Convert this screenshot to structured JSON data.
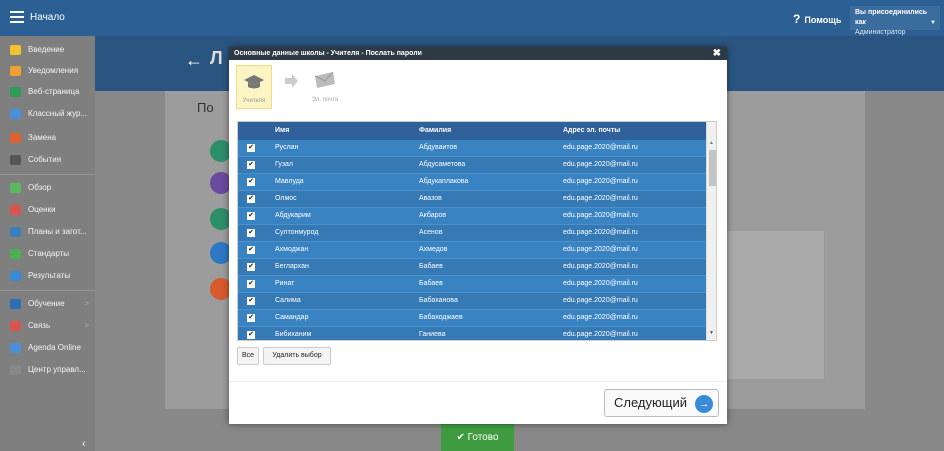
{
  "topbar": {
    "home_label": "Начало",
    "help_label": "Помощь",
    "user_line1": "Вы присоединились как",
    "user_line2": "Администратор"
  },
  "sidebar": {
    "items": [
      {
        "label": "Введение",
        "icon": "star-icon",
        "color": "#f2c12e"
      },
      {
        "label": "Уведомления",
        "icon": "envelope-icon",
        "color": "#f0a030"
      },
      {
        "label": "Веб-страница",
        "icon": "home-icon",
        "color": "#2e9d5a"
      },
      {
        "label": "Классный жур...",
        "icon": "journal-icon",
        "color": "#4a90d9"
      },
      {
        "label": "Замена",
        "icon": "person-icon",
        "color": "#e06030"
      },
      {
        "label": "События",
        "icon": "calendar-icon",
        "color": "#555555"
      },
      {
        "label": "Обзор",
        "icon": "circle-icon",
        "color": "#5cb85c"
      },
      {
        "label": "Оценки",
        "icon": "grade-icon",
        "color": "#d9534f"
      },
      {
        "label": "Планы и загот...",
        "icon": "plan-icon",
        "color": "#3c7fbf"
      },
      {
        "label": "Стандарты",
        "icon": "shield-icon",
        "color": "#4caf50"
      },
      {
        "label": "Результаты",
        "icon": "bar-chart-icon",
        "color": "#3a8ad4"
      },
      {
        "label": "Обучение",
        "icon": "book-icon",
        "color": "#2d6fb5"
      },
      {
        "label": "Связь",
        "icon": "chat-icon",
        "color": "#d9534f"
      },
      {
        "label": "Agenda Online",
        "icon": "pen-icon",
        "color": "#4a90d9"
      },
      {
        "label": "Центр управл...",
        "icon": "gear-icon",
        "color": "#888888"
      }
    ]
  },
  "background": {
    "title": "Л",
    "subtitle": "По"
  },
  "modal": {
    "title": "Основные данные школы - Учителя - Послать пароли",
    "close": "✖",
    "steps": [
      {
        "label": "Учителя"
      },
      {
        "label": ""
      },
      {
        "label": "Эл. почта"
      }
    ],
    "columns": [
      "Имя",
      "Фамилия",
      "Адрес эл. почты"
    ],
    "rows": [
      [
        "Руслан",
        "Абдуваитов",
        "edu.page.2020@mail.ru"
      ],
      [
        "Гузал",
        "Абдусаметова",
        "edu.page.2020@mail.ru"
      ],
      [
        "Мавлуда",
        "Абдукаплакова",
        "edu.page.2020@mail.ru"
      ],
      [
        "Олмос",
        "Авазов",
        "edu.page.2020@mail.ru"
      ],
      [
        "Абдукарим",
        "Акбаров",
        "edu.page.2020@mail.ru"
      ],
      [
        "Султонмурод",
        "Асенов",
        "edu.page.2020@mail.ru"
      ],
      [
        "Ахмоджан",
        "Ахмедов",
        "edu.page.2020@mail.ru"
      ],
      [
        "Беглархан",
        "Бабаев",
        "edu.page.2020@mail.ru"
      ],
      [
        "Ринат",
        "Бабаев",
        "edu.page.2020@mail.ru"
      ],
      [
        "Салима",
        "Бабаханова",
        "edu.page.2020@mail.ru"
      ],
      [
        "Самандар",
        "Бабаходжаев",
        "edu.page.2020@mail.ru"
      ],
      [
        "Бибиханим",
        "Ганиева",
        "edu.page.2020@mail.ru"
      ]
    ],
    "select_all": "Все",
    "clear_selection": "Удалить выбор",
    "next_label": "Следующий"
  },
  "ready_label": "✔ Готово"
}
